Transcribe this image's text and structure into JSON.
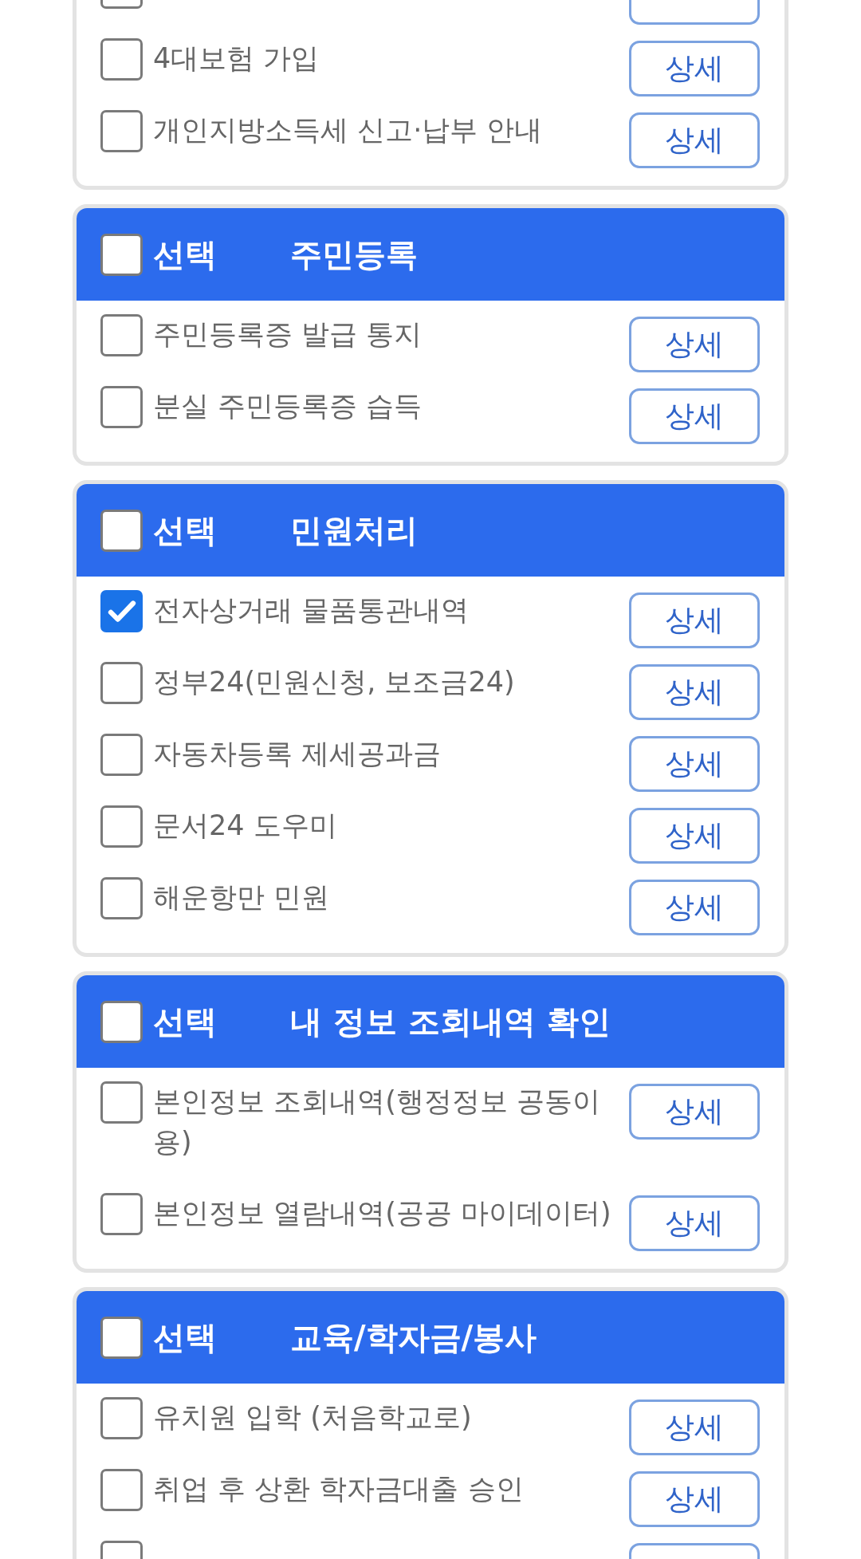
{
  "sections": [
    {
      "items": [
        {
          "checked": false
        },
        {
          "label": "4대보험 가입",
          "checked": false,
          "button": "상세"
        },
        {
          "label": "개인지방소득세 신고·납부 안내",
          "checked": false,
          "button": "상세"
        }
      ]
    },
    {
      "header": {
        "checked": false,
        "select_label": "선택",
        "title": "주민등록"
      },
      "items": [
        {
          "label": "주민등록증 발급 통지",
          "checked": false,
          "button": "상세"
        },
        {
          "label": "분실 주민등록증 습득",
          "checked": false,
          "button": "상세"
        }
      ]
    },
    {
      "header": {
        "checked": false,
        "select_label": "선택",
        "title": "민원처리"
      },
      "items": [
        {
          "label": "전자상거래 물품통관내역",
          "checked": true,
          "button": "상세"
        },
        {
          "label": "정부24(민원신청, 보조금24)",
          "checked": false,
          "button": "상세"
        },
        {
          "label": "자동차등록 제세공과금",
          "checked": false,
          "button": "상세"
        },
        {
          "label": "문서24 도우미",
          "checked": false,
          "button": "상세"
        },
        {
          "label": "해운항만 민원",
          "checked": false,
          "button": "상세"
        }
      ]
    },
    {
      "header": {
        "checked": false,
        "select_label": "선택",
        "title": "내 정보 조회내역 확인"
      },
      "items": [
        {
          "label": "본인정보 조회내역(행정정보 공동이용)",
          "checked": false,
          "button": "상세"
        },
        {
          "label": "본인정보 열람내역(공공 마이데이터)",
          "checked": false,
          "button": "상세"
        }
      ]
    },
    {
      "header": {
        "checked": false,
        "select_label": "선택",
        "title": "교육/학자금/봉사"
      },
      "items": [
        {
          "label": "유치원 입학 (처음학교로)",
          "checked": false,
          "button": "상세"
        },
        {
          "label": "취업 후 상환 학자금대출 승인",
          "checked": false,
          "button": "상세"
        },
        {
          "checked": false
        }
      ]
    }
  ]
}
